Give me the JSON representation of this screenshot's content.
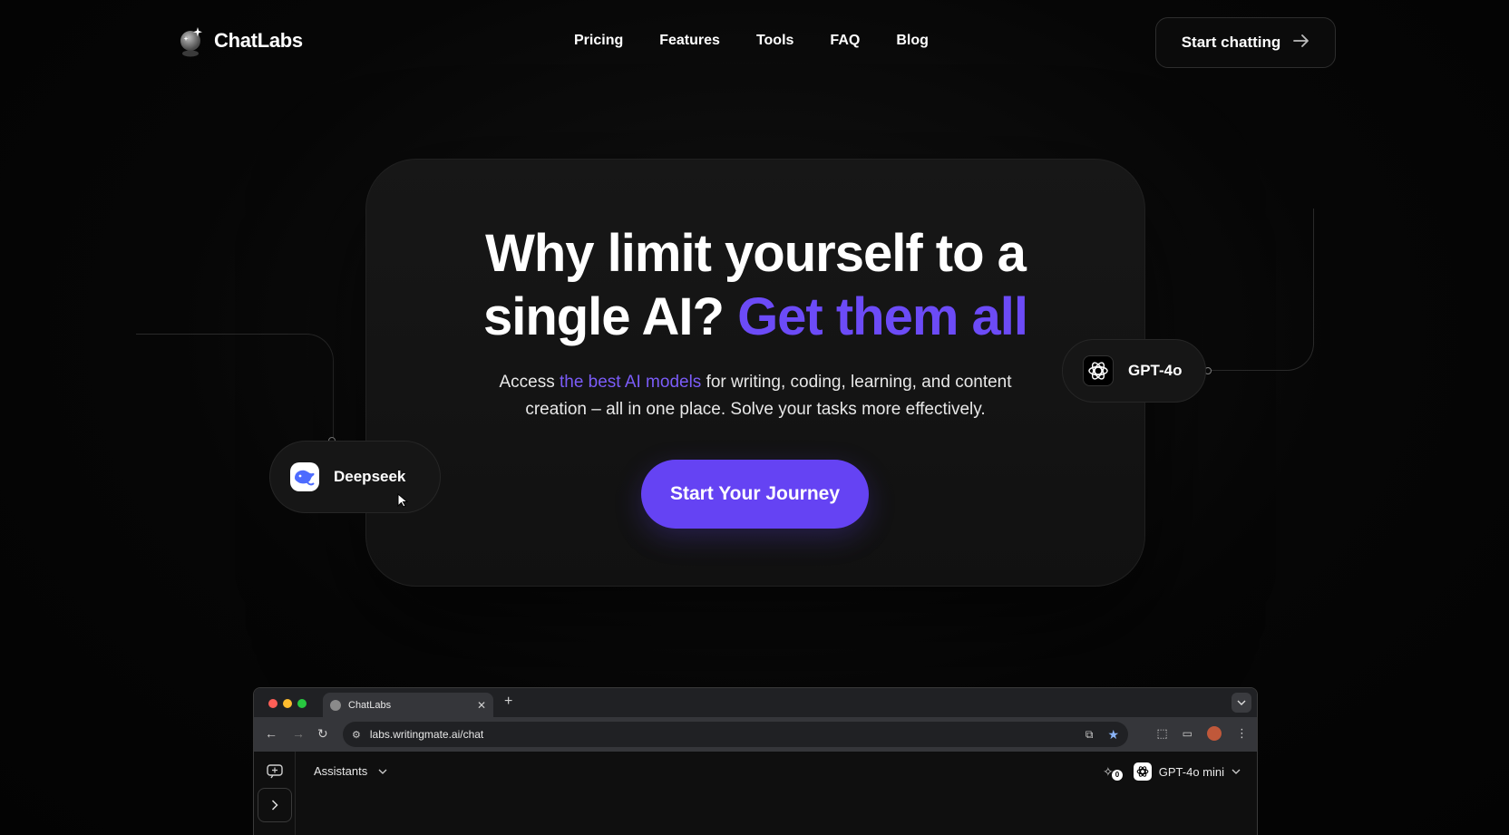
{
  "brand": {
    "name": "ChatLabs"
  },
  "nav": {
    "items": [
      "Pricing",
      "Features",
      "Tools",
      "FAQ",
      "Blog"
    ]
  },
  "header": {
    "cta_label": "Start chatting"
  },
  "hero": {
    "headline_line1": "Why limit yourself to a",
    "headline_line2_plain": "single AI? ",
    "headline_line2_accent": "Get them all",
    "sub_pre": "Access ",
    "sub_accent": "the best AI models",
    "sub_post_line1": " for writing, coding, learning, and content",
    "sub_line2": "creation – all in one place. Solve your tasks more effectively.",
    "button_label": "Start Your Journey"
  },
  "pills": {
    "left_label": "Deepseek",
    "right_label": "GPT-4o"
  },
  "browser": {
    "tab_title": "ChatLabs",
    "url": "labs.writingmate.ai/chat",
    "assistants_label": "Assistants",
    "model_label": "GPT-4o mini",
    "plugin_count": "0"
  },
  "colors": {
    "accent": "#6543f3",
    "accent_text": "#6c4bf7",
    "background": "#050505"
  },
  "icons": [
    "crystal-ball-icon",
    "arrow-right-icon",
    "deepseek-whale-icon",
    "openai-icon",
    "cursor-icon",
    "chevron-down-icon",
    "new-chat-icon",
    "chevron-right-icon",
    "plugin-icon"
  ]
}
